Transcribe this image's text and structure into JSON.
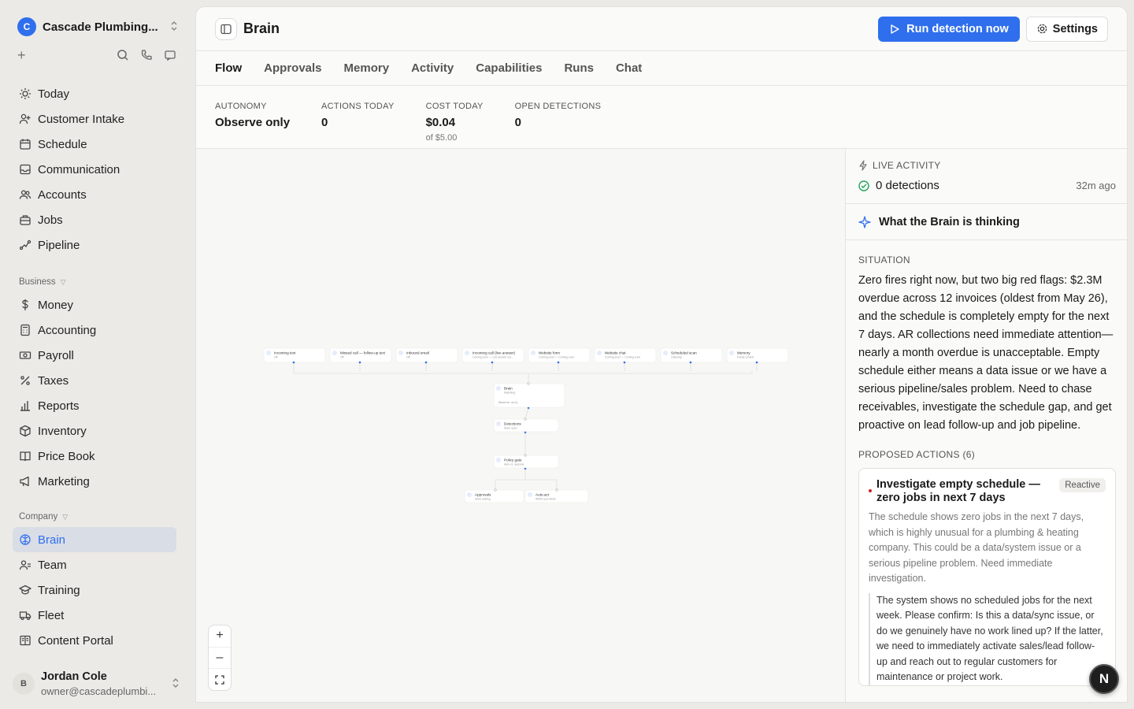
{
  "org": {
    "badge": "C",
    "name": "Cascade Plumbing..."
  },
  "nav_main": [
    {
      "label": "Today",
      "icon": "sun-icon"
    },
    {
      "label": "Customer Intake",
      "icon": "user-plus-icon"
    },
    {
      "label": "Schedule",
      "icon": "calendar-icon"
    },
    {
      "label": "Communication",
      "icon": "inbox-icon"
    },
    {
      "label": "Accounts",
      "icon": "users-icon"
    },
    {
      "label": "Jobs",
      "icon": "briefcase-icon"
    },
    {
      "label": "Pipeline",
      "icon": "pipeline-icon"
    }
  ],
  "section_business": "Business",
  "nav_business": [
    {
      "label": "Money",
      "icon": "dollar-icon"
    },
    {
      "label": "Accounting",
      "icon": "calculator-icon"
    },
    {
      "label": "Payroll",
      "icon": "cash-icon"
    },
    {
      "label": "Taxes",
      "icon": "percent-icon"
    },
    {
      "label": "Reports",
      "icon": "bar-chart-icon"
    },
    {
      "label": "Inventory",
      "icon": "box-icon"
    },
    {
      "label": "Price Book",
      "icon": "book-icon"
    },
    {
      "label": "Marketing",
      "icon": "megaphone-icon"
    }
  ],
  "section_company": "Company",
  "nav_company": [
    {
      "label": "Brain",
      "icon": "brain-icon",
      "active": true
    },
    {
      "label": "Team",
      "icon": "team-icon"
    },
    {
      "label": "Training",
      "icon": "graduation-icon"
    },
    {
      "label": "Fleet",
      "icon": "truck-icon"
    },
    {
      "label": "Content Portal",
      "icon": "book-open-icon"
    }
  ],
  "user": {
    "avatar": "B",
    "name": "Jordan Cole",
    "email": "owner@cascadeplumbi..."
  },
  "header": {
    "title": "Brain",
    "run_label": "Run detection now",
    "settings_label": "Settings"
  },
  "tabs": [
    "Flow",
    "Approvals",
    "Memory",
    "Activity",
    "Capabilities",
    "Runs",
    "Chat"
  ],
  "stats": {
    "autonomy_label": "AUTONOMY",
    "autonomy_value": "Observe only",
    "actions_label": "ACTIONS TODAY",
    "actions_value": "0",
    "cost_label": "COST TODAY",
    "cost_value": "$0.04",
    "cost_sub": "of $5.00",
    "open_label": "OPEN DETECTIONS",
    "open_value": "0"
  },
  "flow": {
    "sources": [
      {
        "title": "Incoming text",
        "sub": "Off"
      },
      {
        "title": "Missed call — follow-up text",
        "sub": "Off"
      },
      {
        "title": "Inbound email",
        "sub": "Off"
      },
      {
        "title": "Incoming call (live answer)",
        "sub": "Coming soon — Live answer via..."
      },
      {
        "title": "Website form",
        "sub": "Coming soon — Coming soon"
      },
      {
        "title": "Website chat",
        "sub": "Coming soon — Coming soon"
      },
      {
        "title": "Scheduled scan",
        "sub": "Listening"
      },
      {
        "title": "Memory",
        "sub": "Feeds context"
      }
    ],
    "brain": {
      "title": "Brain",
      "sub": "Watching",
      "mode": "Observe only"
    },
    "detections": {
      "title": "Detections",
      "sub": "None open"
    },
    "policy": {
      "title": "Policy gate",
      "sub": "Auto vs. approve"
    },
    "approvals": {
      "title": "Approvals",
      "sub": "None waiting"
    },
    "autoact": {
      "title": "Auto-act",
      "sub": "Within your limits"
    }
  },
  "live": {
    "label": "LIVE ACTIVITY",
    "detections": "0 detections",
    "ago": "32m ago"
  },
  "thinking_label": "What the Brain is thinking",
  "situation": {
    "label": "SITUATION",
    "text": "Zero fires right now, but two big red flags: $2.3M overdue across 12 invoices (oldest from May 26), and the schedule is completely empty for the next 7 days. AR collections need immediate attention—nearly a month overdue is unacceptable. Empty schedule either means a data issue or we have a serious pipeline/sales problem. Need to chase receivables, investigate the schedule gap, and get proactive on lead follow-up and job pipeline."
  },
  "proposed": {
    "label": "PROPOSED ACTIONS (6)",
    "card": {
      "title": "Investigate empty schedule — zero jobs in next 7 days",
      "badge": "Reactive",
      "desc": "The schedule shows zero jobs in the next 7 days, which is highly unusual for a plumbing & heating company. This could be a data/system issue or a serious pipeline problem. Need immediate investigation.",
      "quote": "The system shows no scheduled jobs for the next week. Please confirm: Is this a data/sync issue, or do we genuinely have no work lined up? If the latter, we need to immediately activate sales/lead follow-up and reach out to regular customers for maintenance or project work."
    }
  },
  "fab_label": "N",
  "colors": {
    "accent": "#2f6fed",
    "success": "#22a35a",
    "danger": "#d02020"
  }
}
